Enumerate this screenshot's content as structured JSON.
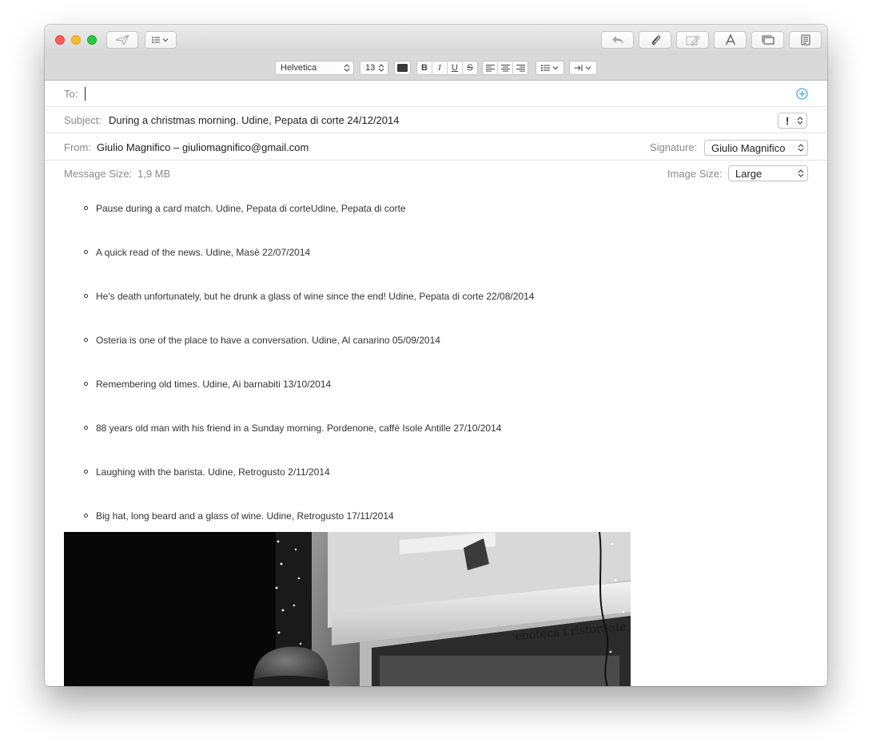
{
  "format": {
    "font": "Helvetica",
    "size": "13",
    "bold": "B",
    "italic": "I",
    "underline": "U",
    "strike": "S"
  },
  "header": {
    "to_label": "To:",
    "to_value": "",
    "subject_label": "Subject:",
    "subject_value": "During a christmas morning. Udine, Pepata di corte 24/12/2014",
    "priority": "!",
    "from_label": "From:",
    "from_value": "Giulio Magnifico – giuliomagnifico@gmail.com",
    "signature_label": "Signature:",
    "signature_value": "Giulio Magnifico",
    "message_size_label": "Message Size:",
    "message_size_value": "1,9 MB",
    "image_size_label": "Image Size:",
    "image_size_value": "Large"
  },
  "body": {
    "captions": [
      "Pause during a card match. Udine, Pepata di corteUdine, Pepata di corte",
      "A quick read of the news. Udine, Masè 22/07/2014",
      "He's death unfortunately, but he drunk a glass of wine since the end! Udine, Pepata di corte 22/08/2014",
      "Osteria is one of the place to have a conversation. Udine, Al canarino 05/09/2014",
      "Remembering old times. Udine, Ai barnabiti 13/10/2014",
      "88 years old man with his friend in a Sunday morning. Pordenone, caffè Isole Antille 27/10/2014",
      "Laughing with the barista. Udine, Retrogusto 2/11/2014",
      "Big hat, long beard and a glass of wine. Udine, Retrogusto 17/11/2014"
    ],
    "photo_sign": "enoteca i ristorante"
  },
  "colors": {
    "add_contact_accent": "#2a9bd8"
  }
}
